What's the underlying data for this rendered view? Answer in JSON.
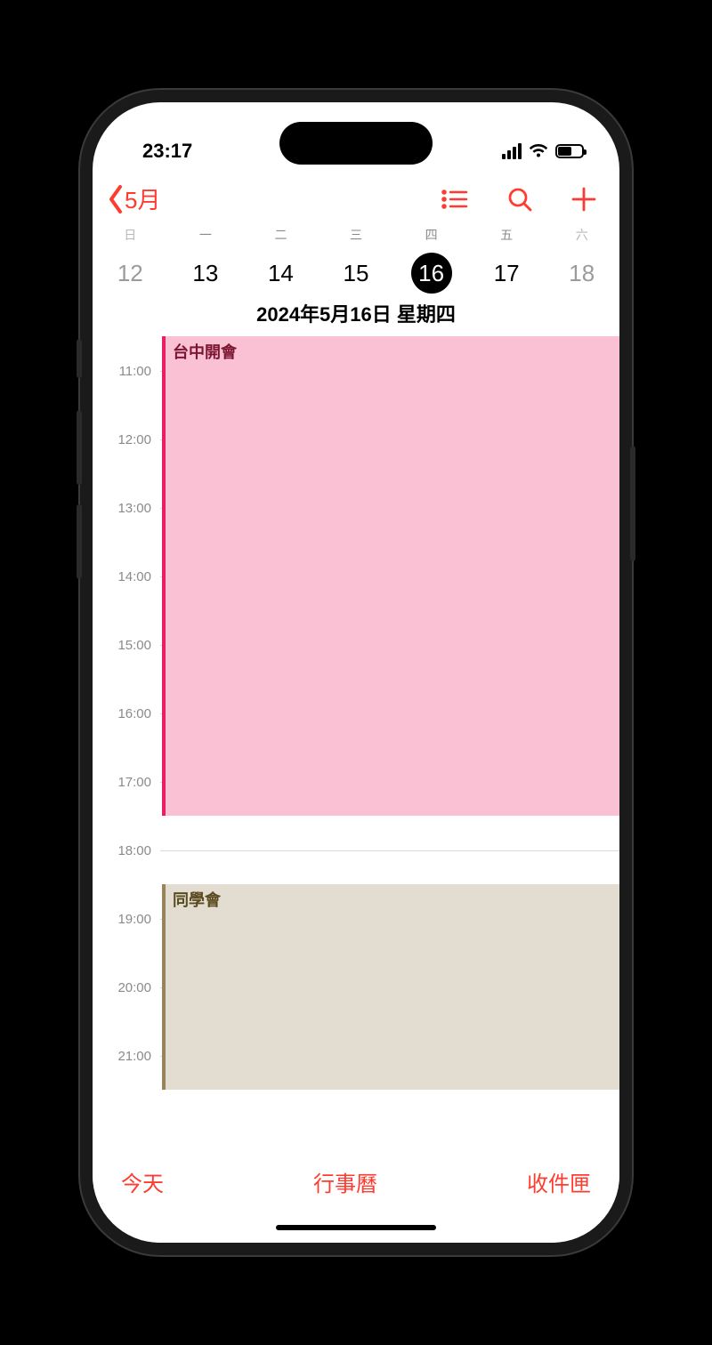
{
  "status": {
    "time": "23:17"
  },
  "nav": {
    "back_label": "5月"
  },
  "week": {
    "weekdays": [
      "日",
      "一",
      "二",
      "三",
      "四",
      "五",
      "六"
    ],
    "days": [
      "12",
      "13",
      "14",
      "15",
      "16",
      "17",
      "18"
    ],
    "today_index": 4
  },
  "full_date": "2024年5月16日 星期四",
  "timeline": {
    "start_hour": 10.5,
    "hour_height": 77,
    "hours": [
      "11:00",
      "12:00",
      "13:00",
      "14:00",
      "15:00",
      "16:00",
      "17:00",
      "18:00",
      "19:00",
      "20:00",
      "21:00"
    ],
    "events": [
      {
        "title": "台中開會",
        "start": 10.5,
        "end": 17.5,
        "style": "pink"
      },
      {
        "title": "同學會",
        "start": 18.5,
        "end": 21.5,
        "style": "tan"
      }
    ]
  },
  "toolbar": {
    "today": "今天",
    "calendars": "行事曆",
    "inbox": "收件匣"
  }
}
